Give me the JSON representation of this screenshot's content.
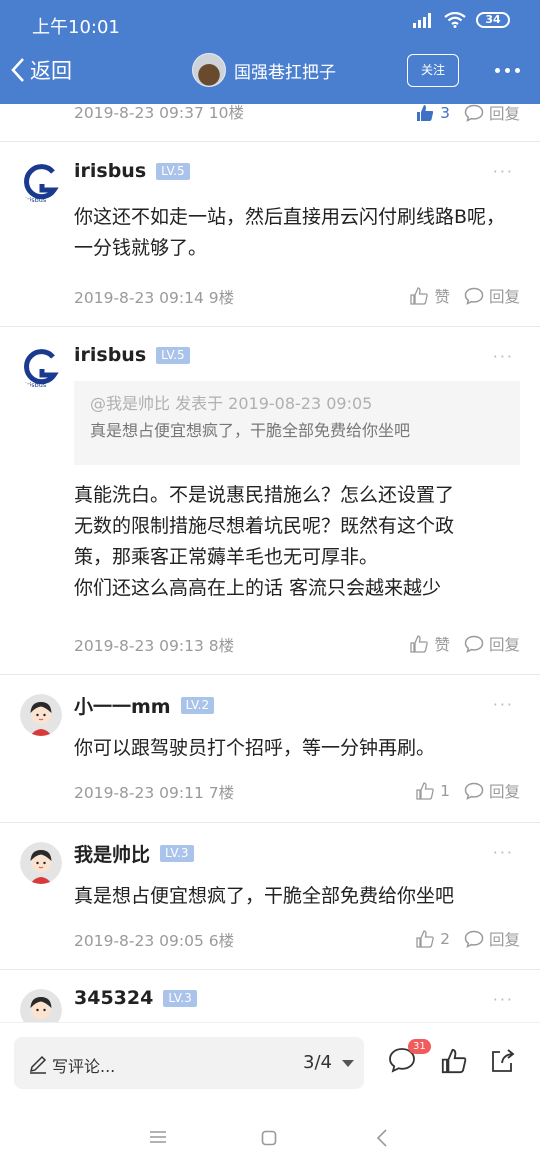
{
  "status_bar": {
    "time": "上午10:01",
    "battery": "34"
  },
  "header": {
    "back_label": "返回",
    "title": "国强巷扛把子",
    "follow_label": "关注"
  },
  "top_post": {
    "meta": "2019-8-23 09:37  10楼",
    "like_count": "3",
    "reply_label": "回复"
  },
  "posts": [
    {
      "username": "irisbus",
      "level": "LV.5",
      "content": "你这还不如走一站，然后直接用云闪付刷线路B呢，一分钱就够了。",
      "meta": "2019-8-23 09:14  9楼",
      "like_label": "赞",
      "reply_label": "回复"
    },
    {
      "username": "irisbus",
      "level": "LV.5",
      "quote_head": "@我是帅比 发表于 2019-08-23 09:05",
      "quote_body": "真是想占便宜想疯了，干脆全部免费给你坐吧",
      "content_lines": [
        "真能洗白。不是说惠民措施么？怎么还设置了",
        "无数的限制措施尽想着坑民呢？既然有这个政",
        "策，那乘客正常薅羊毛也无可厚非。",
        "你们还这么高高在上的话 客流只会越来越少"
      ],
      "meta": "2019-8-23 09:13  8楼",
      "like_label": "赞",
      "reply_label": "回复"
    },
    {
      "username": "小一一mm",
      "level": "LV.2",
      "content": "你可以跟驾驶员打个招呼，等一分钟再刷。",
      "meta": "2019-8-23 09:11  7楼",
      "like_label": "1",
      "reply_label": "回复"
    },
    {
      "username": "我是帅比",
      "level": "LV.3",
      "content": "真是想占便宜想疯了，干脆全部免费给你坐吧",
      "meta": "2019-8-23 09:05  6楼",
      "like_label": "2",
      "reply_label": "回复"
    },
    {
      "username": "345324",
      "level": "LV.3"
    }
  ],
  "bottom_bar": {
    "comment_placeholder": "写评论...",
    "page": "3/4",
    "comment_badge": "31"
  },
  "icons": {
    "back": "chevron-left-icon",
    "more": "more-dots-icon",
    "like": "thumbs-up-icon",
    "reply": "speech-bubble-icon",
    "edit": "pencil-icon",
    "share": "share-icon"
  },
  "colors": {
    "header_bg": "#4a7fd0",
    "level_badge": "#a9c3ea",
    "like_active": "#3f72c4",
    "badge": "#f25b5b"
  }
}
